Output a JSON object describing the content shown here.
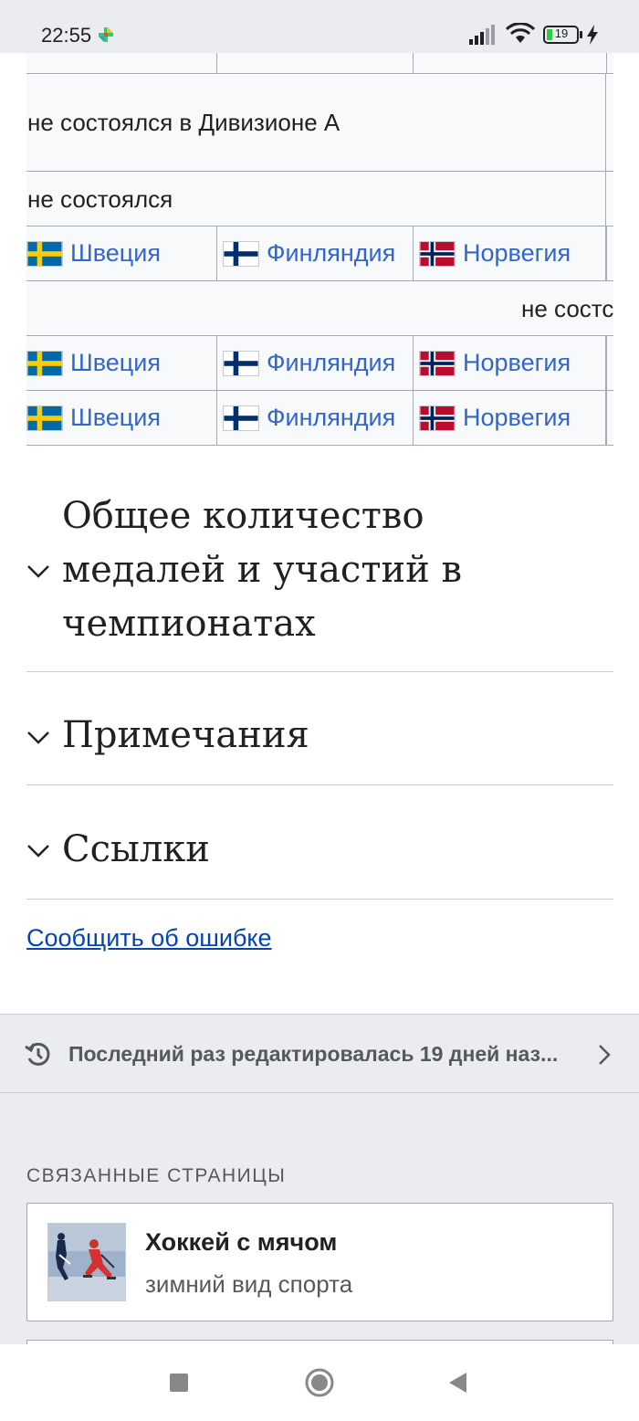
{
  "status_bar": {
    "time": "22:55",
    "battery": "19",
    "icons": [
      "notification-icon",
      "signal-icon",
      "wifi-icon",
      "battery-icon",
      "charging-icon"
    ]
  },
  "table": {
    "rows": [
      {
        "type": "text",
        "text": ""
      },
      {
        "type": "text",
        "text": "не состоялся в Дивизионе А"
      },
      {
        "type": "text",
        "text": "не состоялся"
      },
      {
        "type": "medals",
        "cells": [
          {
            "country": "Швеция",
            "flag": "sweden"
          },
          {
            "country": "Финляндия",
            "flag": "finland"
          },
          {
            "country": "Норвегия",
            "flag": "norway"
          }
        ]
      },
      {
        "type": "text-right",
        "text": "не состс"
      },
      {
        "type": "medals",
        "cells": [
          {
            "country": "Швеция",
            "flag": "sweden"
          },
          {
            "country": "Финляндия",
            "flag": "finland"
          },
          {
            "country": "Норвегия",
            "flag": "norway"
          }
        ]
      },
      {
        "type": "medals",
        "cells": [
          {
            "country": "Швеция",
            "flag": "sweden"
          },
          {
            "country": "Финляндия",
            "flag": "finland"
          },
          {
            "country": "Норвегия",
            "flag": "norway"
          }
        ]
      }
    ]
  },
  "sections": [
    {
      "title": "Общее количество медалей и участий в чемпионатах"
    },
    {
      "title": "Примечания"
    },
    {
      "title": "Ссылки"
    }
  ],
  "report_link": "Сообщить об ошибке",
  "footer": {
    "last_edited": "Последний раз редактировалась 19 дней наз...",
    "related_heading": "СВЯЗАННЫЕ СТРАНИЦЫ",
    "related": [
      {
        "title": "Хоккей с мячом",
        "description": "зимний вид спорта"
      }
    ]
  },
  "colors": {
    "link": "#3366cc",
    "link_visited": "#0645ad",
    "table_bg": "#f8f9fa",
    "border": "#a2a9b1",
    "footer_bg": "#eaecf0"
  }
}
